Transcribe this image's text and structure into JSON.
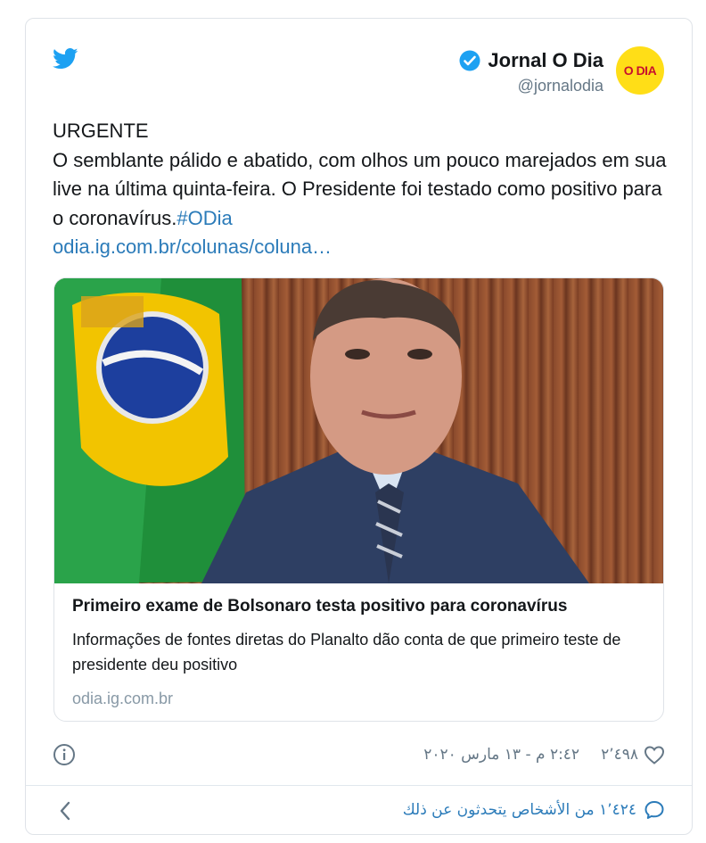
{
  "brand": {
    "accent": "#1da1f2",
    "link": "#2b7bb9",
    "muted": "#657786"
  },
  "author": {
    "name": "Jornal O Dia",
    "handle": "@jornalodia",
    "avatar_text": "O DIA"
  },
  "tweet": {
    "line1": "URGENTE",
    "body": "O semblante pálido e abatido, com olhos um pouco marejados em sua live na última quinta-feira. O Presidente foi testado como positivo para o coronavírus.",
    "hashtag": "#ODia",
    "link": "odia.ig.com.br/colunas/coluna…"
  },
  "link_card": {
    "title": "Primeiro exame de Bolsonaro testa positivo para coronavírus",
    "description": "Informações de fontes diretas do Planalto dão conta de que primeiro teste de presidente deu positivo",
    "domain": "odia.ig.com.br"
  },
  "meta": {
    "timestamp": "٢:٤٢ م - ١٣ مارس ٢٠٢٠",
    "likes": "٢٬٤٩٨"
  },
  "footer": {
    "people_talking": "١٬٤٢٤ من الأشخاص يتحدثون عن ذلك"
  }
}
